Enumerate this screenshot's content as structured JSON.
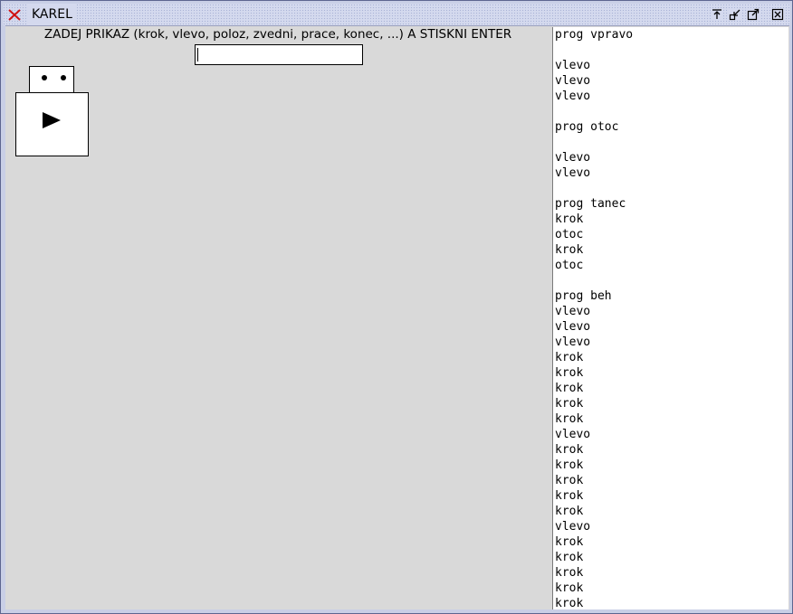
{
  "window": {
    "title": "KAREL",
    "icon": "x-close-icon",
    "controls": [
      "raise-icon",
      "minimize-icon",
      "maximize-icon",
      "close-icon"
    ],
    "colors": {
      "frame": "#c9cfe6",
      "client": "#d9d9d9",
      "icon_red": "#d01010"
    }
  },
  "command": {
    "prompt": "ZADEJ PRIKAZ (krok, vlevo, poloz, zvedni, prace, konec, ...) A STISKNI ENTER",
    "value": ""
  },
  "robot": {
    "direction": "east"
  },
  "program": {
    "lines": [
      "prog vpravo",
      "",
      "vlevo",
      "vlevo",
      "vlevo",
      "",
      "prog otoc",
      "",
      "vlevo",
      "vlevo",
      "",
      "prog tanec",
      "krok",
      "otoc",
      "krok",
      "otoc",
      "",
      "prog beh",
      "vlevo",
      "vlevo",
      "vlevo",
      "krok",
      "krok",
      "krok",
      "krok",
      "krok",
      "vlevo",
      "krok",
      "krok",
      "krok",
      "krok",
      "krok",
      "vlevo",
      "krok",
      "krok",
      "krok",
      "krok",
      "krok"
    ]
  }
}
